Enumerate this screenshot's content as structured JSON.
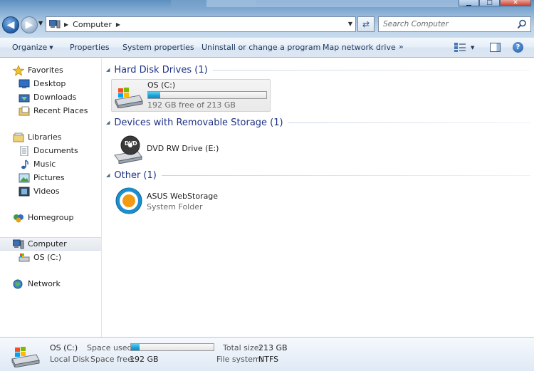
{
  "window": {
    "minimize_glyph": "▁",
    "maximize_glyph": "□",
    "close_glyph": "✕"
  },
  "address_bar": {
    "location": "Computer",
    "search_placeholder": "Search Computer"
  },
  "toolbar": {
    "organize_label": "Organize",
    "properties_label": "Properties",
    "system_properties_label": "System properties",
    "uninstall_label": "Uninstall or change a program",
    "map_drive_label": "Map network drive",
    "more_label": "»",
    "help_label": "?"
  },
  "nav": {
    "favorites": "Favorites",
    "desktop": "Desktop",
    "downloads": "Downloads",
    "recent_places": "Recent Places",
    "libraries": "Libraries",
    "documents": "Documents",
    "music": "Music",
    "pictures": "Pictures",
    "videos": "Videos",
    "homegroup": "Homegroup",
    "computer": "Computer",
    "os_c": "OS (C:)",
    "network": "Network"
  },
  "groups": {
    "hard_disk": {
      "title": "Hard Disk Drives (1)",
      "drive_name": "OS (C:)",
      "free_text": "192 GB free of 213 GB",
      "used_fraction": 0.1
    },
    "removable": {
      "title": "Devices with Removable Storage (1)",
      "drive_name": "DVD RW Drive (E:)",
      "dvd_badge": "DVD"
    },
    "other": {
      "title": "Other (1)",
      "item_name": "ASUS WebStorage",
      "item_type": "System Folder"
    }
  },
  "details": {
    "drive_name": "OS (C:)",
    "drive_type": "Local Disk",
    "space_used_label": "Space used:",
    "space_free_label": "Space free:",
    "space_free_value": "192 GB",
    "total_size_label": "Total size:",
    "total_size_value": "213 GB",
    "file_system_label": "File system:",
    "file_system_value": "NTFS",
    "used_fraction": 0.1
  },
  "colors": {
    "group_title": "#1e3287",
    "usage_fill": "#1fa7dd",
    "accent": "#1d5aa6"
  }
}
